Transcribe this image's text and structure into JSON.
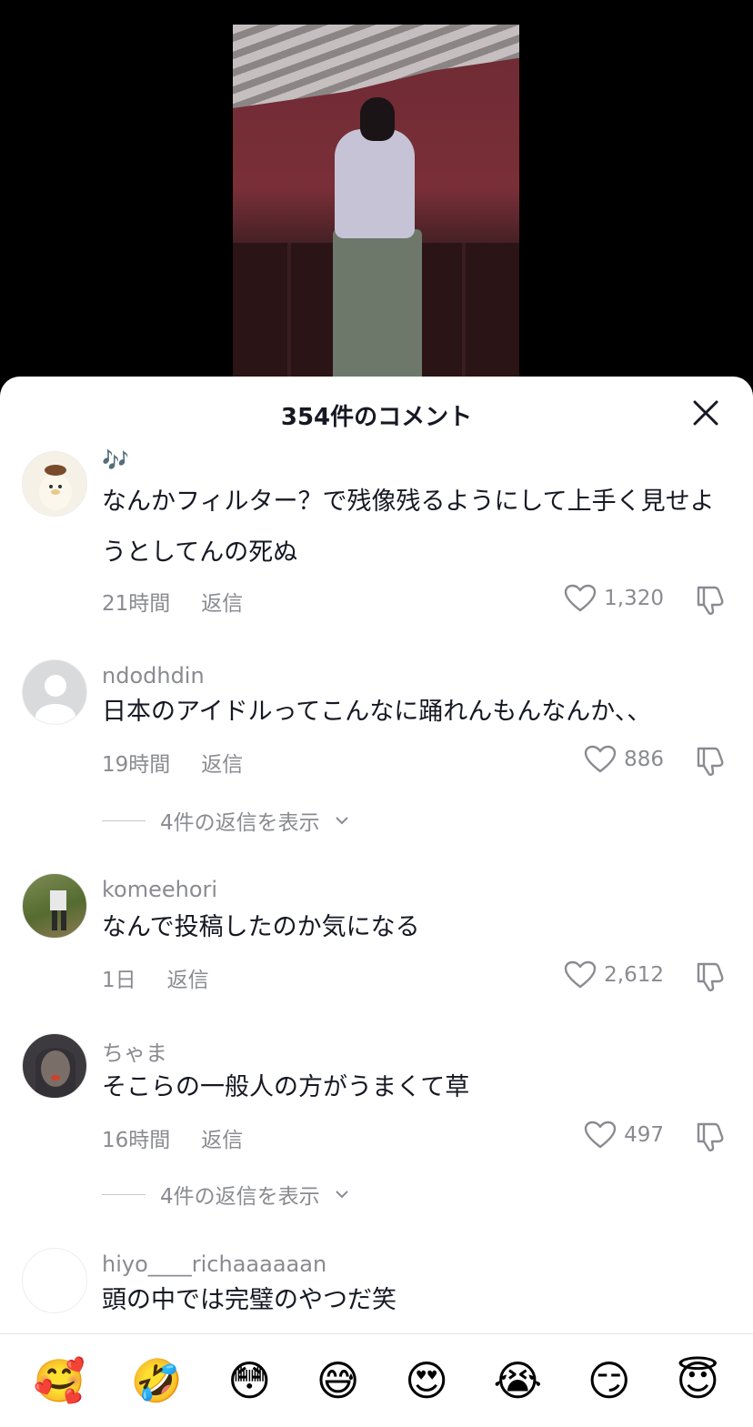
{
  "sheet": {
    "title": "354件のコメント"
  },
  "comments": [
    {
      "user": "🎶",
      "text": "なんかフィルター？で残像残るようにして上手く見せようとしてんの死ぬ",
      "time": "21時間",
      "reply": "返信",
      "likes": "1,320"
    },
    {
      "user": "ndodhdin",
      "text": "日本のアイドルってこんなに踊れんもんなんか、、",
      "time": "19時間",
      "reply": "返信",
      "likes": "886",
      "view_replies": "4件の返信を表示"
    },
    {
      "user": "komeehori",
      "text": "なんで投稿したのか気になる",
      "time": "1日",
      "reply": "返信",
      "likes": "2,612"
    },
    {
      "user": "ちゃま",
      "text": "そこらの一般人の方がうまくて草",
      "time": "16時間",
      "reply": "返信",
      "likes": "497",
      "view_replies": "4件の返信を表示"
    },
    {
      "user": "hiyo____richaaaaaan",
      "text": "頭の中では完璧のやつだ笑"
    }
  ],
  "emojis": [
    "🥰",
    "🤣",
    "😳",
    "😅",
    "😍",
    "😭",
    "😏",
    "😇"
  ]
}
